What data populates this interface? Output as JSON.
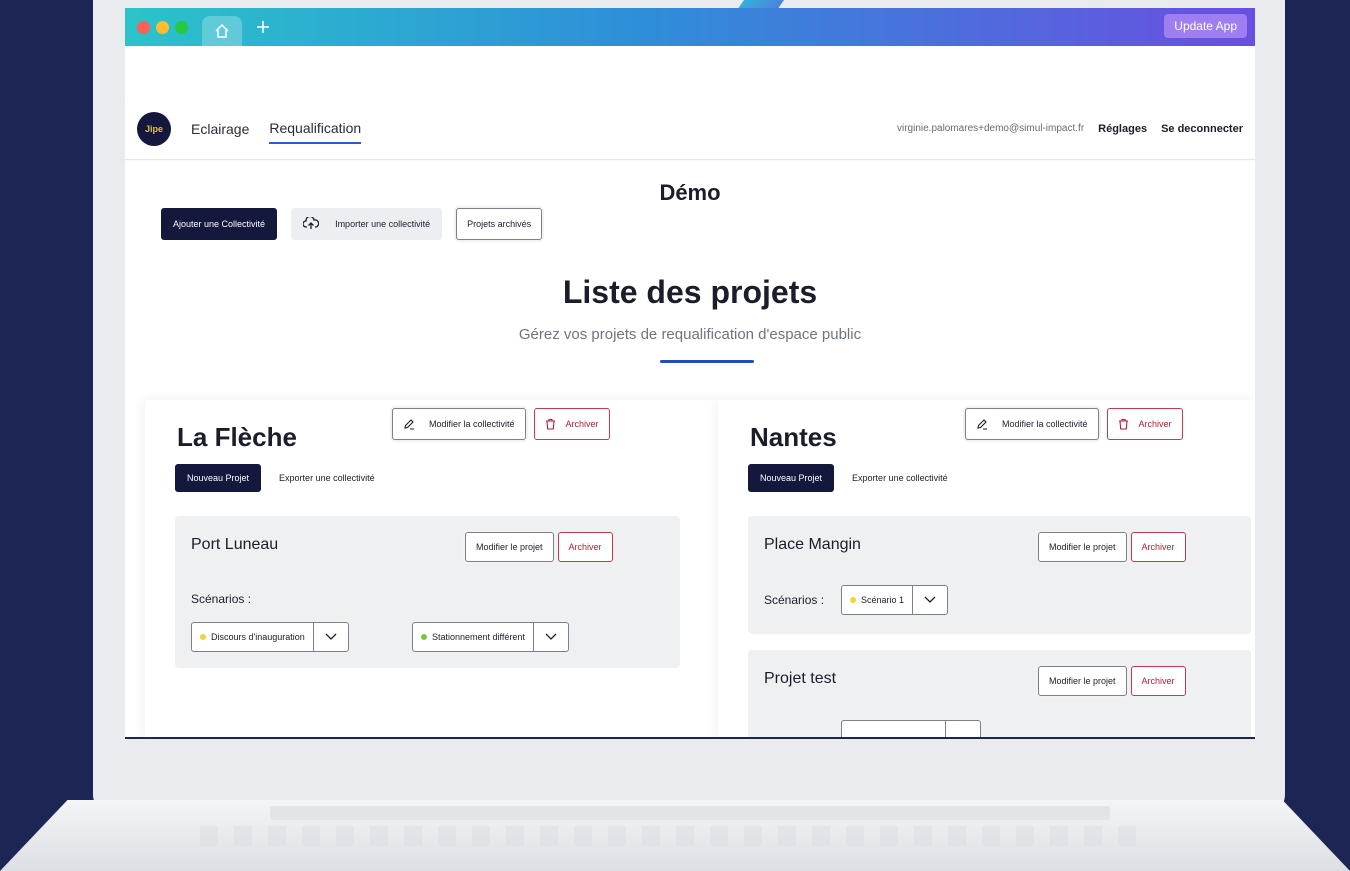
{
  "colors": {
    "background": "#1c2553",
    "dark_button": "#14183d",
    "accent_blue": "#1e4fb3",
    "archive_red": "#b21e35",
    "dot_yellow": "#f2d33a",
    "dot_green": "#7bc63a"
  },
  "titlebar": {
    "home_icon": "home-icon",
    "plus_icon": "plus-icon",
    "update_label": "Update App"
  },
  "nav": {
    "logo_text": "Jipe",
    "links": [
      "Eclairage",
      "Requalification"
    ],
    "active_link": "Requalification",
    "email": "virginie.palomares+demo@simul-impact.fr",
    "settings": "Réglages",
    "logout": "Se deconnecter"
  },
  "page": {
    "title": "Démo",
    "add_button": "Ajouter une Collectivité",
    "import_button": "Importer une collectivité",
    "archived_button": "Projets archivés",
    "list_title": "Liste des projets",
    "list_subtitle": "Gérez vos projets de requalification d'espace public"
  },
  "collectivites": [
    {
      "name": "La Flèche",
      "edit_label": "Modifier la collectivité",
      "archive_label": "Archiver",
      "new_project": "Nouveau Projet",
      "export_label": "Exporter une collectivité",
      "projects": [
        {
          "name": "Port Luneau",
          "edit_label": "Modifier le projet",
          "archive_label": "Archiver",
          "scenarios_label": "Scénarios :",
          "scenarios": [
            {
              "name": "Discours d'inauguration",
              "dot": "yellow"
            },
            {
              "name": "Stationnement différent",
              "dot": "green"
            }
          ]
        }
      ]
    },
    {
      "name": "Nantes",
      "edit_label": "Modifier la collectivité",
      "archive_label": "Archiver",
      "new_project": "Nouveau Projet",
      "export_label": "Exporter une collectivité",
      "projects": [
        {
          "name": "Place Mangin",
          "edit_label": "Modifier le projet",
          "archive_label": "Archiver",
          "scenarios_label": "Scénarios :",
          "scenarios": [
            {
              "name": "Scénario 1",
              "dot": "yellow"
            }
          ]
        },
        {
          "name": "Projet test",
          "edit_label": "Modifier le projet",
          "archive_label": "Archiver"
        }
      ]
    }
  ]
}
